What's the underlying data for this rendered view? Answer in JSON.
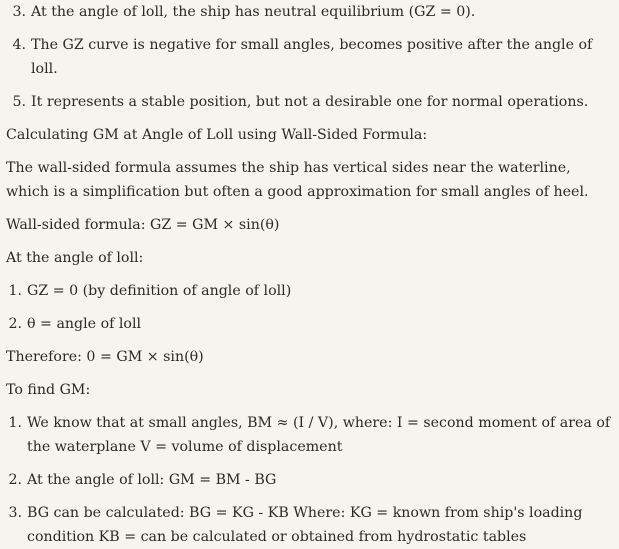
{
  "top_list": [
    {
      "num": "3.",
      "text": "At the angle of loll, the ship has neutral equilibrium (GZ = 0)."
    },
    {
      "num": "4.",
      "text": "The GZ curve is negative for small angles, becomes positive after the angle of loll."
    },
    {
      "num": "5.",
      "text": "It represents a stable position, but not a desirable one for normal operations."
    }
  ],
  "heading_wall_sided": "Calculating GM at Angle of Loll using Wall-Sided Formula:",
  "para_wall_sided": "The wall-sided formula assumes the ship has vertical sides near the waterline, which is a simplification but often a good approximation for small angles of heel.",
  "formula_line": "Wall-sided formula: GZ = GM × sin(θ)",
  "at_angle_label": "At the angle of loll:",
  "angle_list": [
    {
      "num": "1.",
      "text": "GZ = 0 (by definition of angle of loll)"
    },
    {
      "num": "2.",
      "text": "θ = angle of loll"
    }
  ],
  "therefore_line": "Therefore: 0 = GM × sin(θ)",
  "find_gm_label": "To find GM:",
  "gm_list": [
    {
      "num": "1.",
      "text": "We know that at small angles, BM ≈ (I / V), where: I = second moment of area of the waterplane V = volume of displacement"
    },
    {
      "num": "2.",
      "text": "At the angle of loll: GM = BM - BG"
    },
    {
      "num": "3.",
      "text": "BG can be calculated: BG = KG - KB Where: KG = known from ship's loading condition KB = can be calculated or obtained from hydrostatic tables"
    }
  ]
}
